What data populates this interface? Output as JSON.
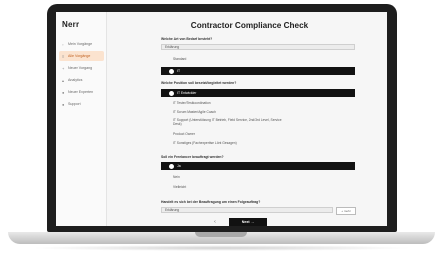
{
  "app": {
    "logo": "Nerr",
    "title": "Contractor Compliance Check"
  },
  "sidebar": {
    "items": [
      {
        "label": "Mein Vorgänge",
        "icon": "file-icon",
        "active": false
      },
      {
        "label": "Alle Vorgänge",
        "icon": "list-icon",
        "active": true
      },
      {
        "label": "Neuer Vorgang",
        "icon": "plus-icon",
        "active": false
      },
      {
        "label": "Analytics",
        "icon": "chart-icon",
        "active": false
      },
      {
        "label": "Neuer Experten",
        "icon": "user-icon",
        "active": false
      },
      {
        "label": "Support",
        "icon": "help-icon",
        "active": false
      }
    ]
  },
  "form": {
    "q1": {
      "label": "Welche Art von Bedarf besteht?",
      "input": "Erklärung",
      "options": [
        "Standard"
      ],
      "selected": "IT"
    },
    "q2": {
      "label": "Welche Position soll besetzt/begleitet werden?",
      "selected": "IT Entwickler",
      "options": [
        "IT Tester/Testkoordination",
        "IT Scrum Master/Agile Coach",
        "IT Support (Unterstützung IT Betrieb, Field Service, 2nd/3rd Level, Service Desk)",
        "Product Owner",
        "IT Sonstiges (Fachexpertise Lönt Gesagen)"
      ]
    },
    "q3": {
      "label": "Soll ein Freelancer beauftragt werden?",
      "selected": "Ja",
      "options": [
        "Nein",
        "Vielleicht"
      ]
    },
    "q4": {
      "label": "Handelt es sich bei der Beauftragung um einen Folgeauftrag?",
      "input": "Erklärung",
      "button": "+ mehr"
    }
  },
  "footer": {
    "back": "‹",
    "next": "Next →"
  }
}
